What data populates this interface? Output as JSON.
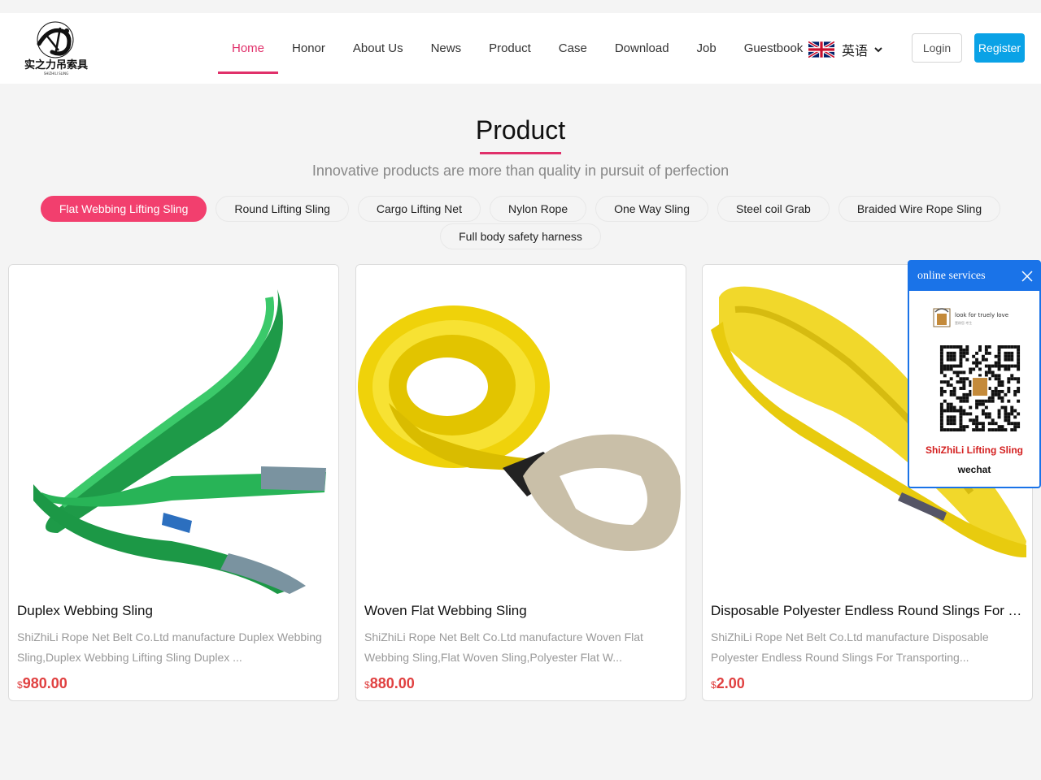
{
  "header": {
    "logo": {
      "icon": "brush-calligraphy-logo",
      "text_cn": "实之力吊索具",
      "text_en": "SHIZHILI SLING"
    },
    "nav": [
      {
        "label": "Home",
        "active": true
      },
      {
        "label": "Honor",
        "active": false
      },
      {
        "label": "About Us",
        "active": false
      },
      {
        "label": "News",
        "active": false
      },
      {
        "label": "Product",
        "active": false
      },
      {
        "label": "Case",
        "active": false
      },
      {
        "label": "Download",
        "active": false
      },
      {
        "label": "Job",
        "active": false
      },
      {
        "label": "Guestbook",
        "active": false
      }
    ],
    "language": {
      "label": "英语",
      "flag_icon": "uk-flag-icon"
    },
    "login_label": "Login",
    "register_label": "Register"
  },
  "section": {
    "title": "Product",
    "subtitle": "Innovative products are more than quality in pursuit of perfection"
  },
  "categories": [
    {
      "label": "Flat Webbing Lifting Sling",
      "active": true
    },
    {
      "label": "Round Lifting Sling",
      "active": false
    },
    {
      "label": "Cargo Lifting Net",
      "active": false
    },
    {
      "label": "Nylon Rope",
      "active": false
    },
    {
      "label": "One Way Sling",
      "active": false
    },
    {
      "label": "Steel coil Grab",
      "active": false
    },
    {
      "label": "Braided Wire Rope Sling",
      "active": false
    },
    {
      "label": "Full body safety harness",
      "active": false
    }
  ],
  "products": [
    {
      "title": "Duplex Webbing Sling",
      "description": "ShiZhiLi Rope Net Belt Co.Ltd manufacture Duplex Webbing Sling,Duplex Webbing Lifting Sling Duplex ...",
      "currency": "$",
      "price": "980.00",
      "image": "green-webbing-sling"
    },
    {
      "title": "Woven Flat Webbing Sling",
      "description": "ShiZhiLi Rope Net Belt Co.Ltd manufacture Woven Flat Webbing Sling,Flat Woven Sling,Polyester Flat W...",
      "currency": "$",
      "price": "880.00",
      "image": "yellow-coiled-webbing-sling"
    },
    {
      "title": "Disposable Polyester Endless Round Slings For Transporting",
      "description": "ShiZhiLi Rope Net Belt Co.Ltd manufacture Disposable Polyester Endless Round Slings For Transporting...",
      "currency": "$",
      "price": "2.00",
      "image": "yellow-endless-round-sling"
    }
  ],
  "chat": {
    "title": "online services",
    "banner_text": "look for truely love",
    "banner_sub": "壹刷您 考生",
    "company": "ShiZhiLi Lifting Sling",
    "label": "wechat"
  },
  "colors": {
    "accent": "#e0306a",
    "pill_active": "#f23f6e",
    "register": "#0aa2e6",
    "chat_blue": "#1a73e8",
    "price": "#e04040"
  }
}
